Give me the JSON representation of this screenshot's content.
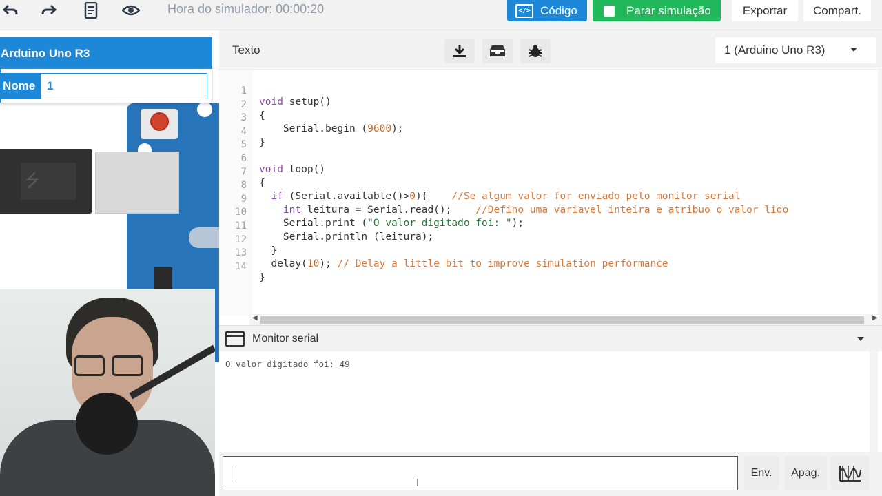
{
  "toolbar": {
    "undo_icon": "undo-icon",
    "redo_icon": "redo-icon",
    "notes_icon": "notes-icon",
    "view_icon": "eye-icon",
    "sim_time": "Hora do simulador: 00:00:20",
    "code_label": "Código",
    "stop_label": "Parar simulação",
    "export_label": "Exportar",
    "share_label": "Compart.",
    "code_color": "#1e88d8",
    "stop_color": "#20b85a"
  },
  "inspector": {
    "title": "Arduino Uno R3",
    "name_label": "Nome",
    "name_value": "1"
  },
  "editor": {
    "mode_label": "Texto",
    "download_icon": "download-icon",
    "library_icon": "library-icon",
    "debug_icon": "bug-icon",
    "device_selected": "1 (Arduino Uno R3)",
    "lines": [
      {
        "n": "1"
      },
      {
        "n": "2"
      },
      {
        "n": "3"
      },
      {
        "n": "4"
      },
      {
        "n": "5"
      },
      {
        "n": "6"
      },
      {
        "n": "7"
      },
      {
        "n": "8"
      },
      {
        "n": "9"
      },
      {
        "n": "10"
      },
      {
        "n": "11"
      },
      {
        "n": "12"
      },
      {
        "n": "13"
      },
      {
        "n": "14"
      }
    ],
    "code": {
      "l1_kw": "void",
      "l1_rest": " setup()",
      "l2": "{",
      "l3_a": "    Serial.begin (",
      "l3_num": "9600",
      "l3_b": ");",
      "l4": "}",
      "l6_kw": "void",
      "l6_rest": " loop()",
      "l7": "{",
      "l8_indent": "  ",
      "l8_kw": "if",
      "l8_a": " (Serial.available()>",
      "l8_num": "0",
      "l8_b": "){    ",
      "l8_cm": "//Se algum valor for enviado pelo monitor serial",
      "l9_indent": "    ",
      "l9_kw": "int",
      "l9_a": " leitura = Serial.read();    ",
      "l9_cm": "//Defino uma variavel inteira e atribuo o valor lido",
      "l10_a": "    Serial.print (",
      "l10_str": "\"O valor digitado foi: \"",
      "l10_b": ");",
      "l11": "    Serial.println (leitura);",
      "l12": "  }",
      "l13_a": "  delay(",
      "l13_num": "10",
      "l13_b": "); ",
      "l13_cm": "// Delay a little bit to improve simulation performance",
      "l14": "}"
    }
  },
  "serial": {
    "title": "Monitor serial",
    "output": "O valor digitado foi: 49",
    "input_value": "",
    "send_label": "Env.",
    "clear_label": "Apag.",
    "graph_icon": "waveform-icon"
  }
}
